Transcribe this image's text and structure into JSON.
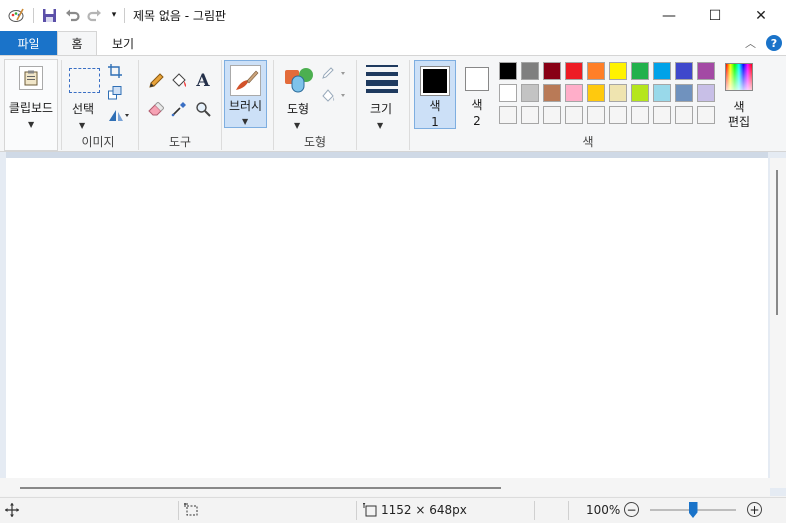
{
  "window": {
    "title": "제목 없음 - 그림판",
    "minimize_glyph": "—",
    "maximize_glyph": "☐",
    "close_glyph": "✕"
  },
  "tabs": {
    "file": "파일",
    "home": "홈",
    "view": "보기"
  },
  "ribbon": {
    "clipboard_label": "클립보드",
    "select_label": "선택",
    "image_group": "이미지",
    "tools_group": "도구",
    "brush_label": "브러시",
    "shapes_label": "도형",
    "shapes_group": "도형",
    "size_label": "크기",
    "color1_label": "색",
    "color1_num": "1",
    "color2_label": "색",
    "color2_num": "2",
    "colors_group": "색",
    "edit_colors_line1": "색",
    "edit_colors_line2": "편집",
    "help_glyph": "?"
  },
  "colors": {
    "color1": "#000000",
    "color2": "#ffffff",
    "accent": "#1a73c9",
    "palette": [
      [
        "#000000",
        "#7f7f7f",
        "#880015",
        "#ed1c24",
        "#ff7f27",
        "#fff200",
        "#22b14c",
        "#00a2e8",
        "#3f48cc",
        "#a349a4"
      ],
      [
        "#ffffff",
        "#c3c3c3",
        "#b97a57",
        "#ffaec9",
        "#ffc90e",
        "#efe4b0",
        "#b5e61d",
        "#99d9ea",
        "#7092be",
        "#c8bfe7"
      ],
      [
        "#f5f5f5",
        "#f5f5f5",
        "#f5f5f5",
        "#f5f5f5",
        "#f5f5f5",
        "#f5f5f5",
        "#f5f5f5",
        "#f5f5f5",
        "#f5f5f5",
        "#f5f5f5"
      ]
    ]
  },
  "status": {
    "canvas_size": "1152 × 648px",
    "zoom": "100%",
    "zoom_out": "−",
    "zoom_in": "+",
    "zoom_level": 0.5
  }
}
